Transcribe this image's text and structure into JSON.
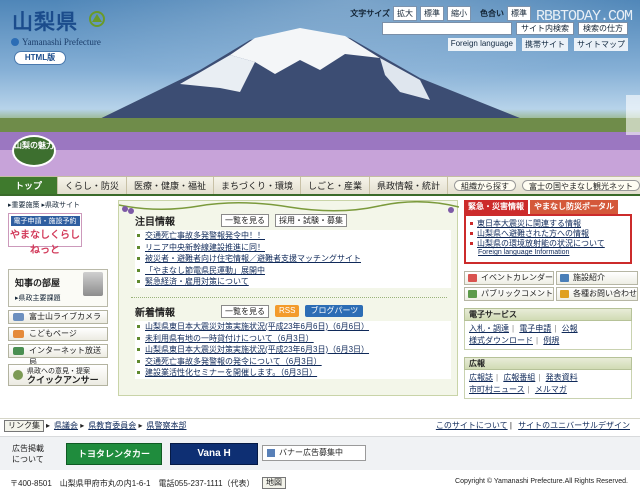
{
  "site": {
    "logo": "山梨県",
    "logo_sub": "Yamanashi Prefecture",
    "html_version": "HTML版",
    "watermark": "RBBTODAY.COM"
  },
  "utility": {
    "text_size_label": "文字サイズ",
    "text_size_buttons": [
      "拡大",
      "標準",
      "縮小"
    ],
    "color_label": "色合い",
    "color_buttons": [
      "標準"
    ],
    "search_placeholder": "",
    "search_button": "サイト内検索",
    "search_help": "検索の仕方",
    "links": [
      "Foreign language",
      "携帯サイト",
      "サイトマップ"
    ]
  },
  "hero": {
    "charm_label": "山梨の魅力"
  },
  "nav": {
    "items": [
      "トップ",
      "くらし・防災",
      "医療・健康・福祉",
      "まちづくり・環境",
      "しごと・産業",
      "県政情報・統計"
    ],
    "pills": [
      "組織から探す",
      "富士の国やまなし観光ネット"
    ]
  },
  "left": {
    "sub_links": [
      "重要施策",
      "県政サイト"
    ],
    "e_app_banner_top": "電子申請・施設予約",
    "e_app_banner_bottom": "やまなしくらしねっと",
    "governor_title": "知事の部屋",
    "governor_link": "県政主要課題",
    "buttons": [
      "富士山ライブカメラ",
      "こどもページ",
      "インターネット放送局"
    ],
    "opinion_small": "県政への意見・提案",
    "opinion_big": "クイックアンサー"
  },
  "attention": {
    "title": "注目情報",
    "list_btn": "一覧を見る",
    "extra_btn": "採用・試験・募集",
    "items": [
      "交通死亡事故多発警報発令中！！",
      "リニア中央新幹線建設推進に同！",
      "被災者・避難者向け住宅情報／避難者支援マッチングサイト",
      "「やまなし節電県民運動」展開中",
      "緊急経済・雇用対策について"
    ]
  },
  "news": {
    "title": "新着情報",
    "list_btn": "一覧を見る",
    "rss_btn": "RSS",
    "blog_btn": "ブログパーツ",
    "items": [
      "山梨県東日本大震災対策実施状況(平成23年6月6日)（6月6日）",
      "未利用県有地の一時貸付けについて（6月3日）",
      "山梨県東日本大震災対策実施状況(平成23年6月3日)（6月3日）",
      "交通死亡事故多発警報の発令について（6月3日）",
      "建設業活性化セミナーを開催します。（6月3日）"
    ]
  },
  "right": {
    "emergency_tab": "緊急・災害情報",
    "bousai_tab": "やまなし防災ポータル",
    "emergency_items": [
      "東日本大震災に関連する情報",
      "山梨県へ避難された方への情報",
      "山梨県の環境放射能の状況について"
    ],
    "foreign_info": "Foreign language Information",
    "quick": [
      "イベントカレンダー",
      "施設紹介",
      "パブリックコメント",
      "各種お問い合わせ"
    ],
    "eservice_title": "電子サービス",
    "eservice_links": [
      "入札・調達",
      "電子申請",
      "公報",
      "様式ダウンロード",
      "例規"
    ],
    "pr_title": "広報",
    "pr_links": [
      "広報誌",
      "広報番組",
      "発表資料",
      "市町村ニュース",
      "メルマガ"
    ]
  },
  "links_bar": {
    "tag": "リンク集",
    "left": [
      "県議会",
      "県教育委員会",
      "県警察本部"
    ],
    "right": [
      "このサイトについて",
      "サイトのユニバーサルデザイン"
    ]
  },
  "ads": {
    "label_line1": "広告掲載",
    "label_line2": "について",
    "ad1": "トヨタレンタカー",
    "ad2": "Vana H",
    "ad3": "バナー広告募集中"
  },
  "footer": {
    "address": "〒400-8501　山梨県甲府市丸の内1-6-1　電話055-237-1111（代表）",
    "map": "地図",
    "copyright": "Copyright © Yamanashi Prefecture.All Rights Reserved."
  }
}
